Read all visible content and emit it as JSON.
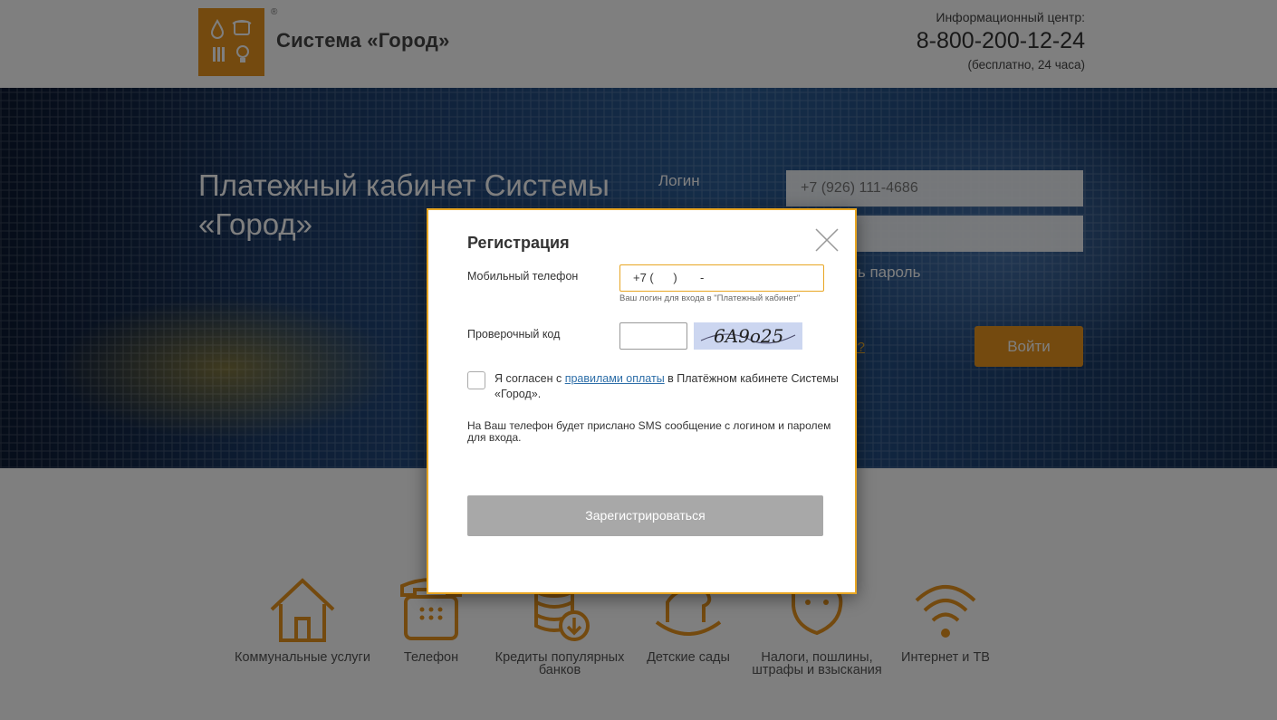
{
  "header": {
    "brand": "Система «Город»",
    "registered_mark": "®",
    "info_label": "Информационный центр:",
    "phone": "8-800-200-12-24",
    "phone_note": "(бесплатно, 24 часа)"
  },
  "hero": {
    "title": "Платежный кабинет Системы «Город»",
    "login_label": "Логин",
    "login_placeholder": "+7 (926) 111-4686",
    "remember_text": "ать пароль",
    "forgot_text": "ль?",
    "login_button": "Войти"
  },
  "services": [
    {
      "label": "Коммунальные услуги",
      "icon": "house-icon"
    },
    {
      "label": "Телефон",
      "icon": "phone-icon"
    },
    {
      "label": "Кредиты популярных банков",
      "icon": "coins-icon"
    },
    {
      "label": "Детские сады",
      "icon": "rocking-horse-icon"
    },
    {
      "label": "Налоги, пошлины, штрафы и взыскания",
      "icon": "piggy-icon"
    },
    {
      "label": "Интернет и ТВ",
      "icon": "wifi-icon"
    }
  ],
  "modal": {
    "title": "Регистрация",
    "phone_label": "Мобильный телефон",
    "phone_value": "+7 (      )       -",
    "phone_hint": "Ваш логин для входа в \"Платежный кабинет\"",
    "code_label": "Проверочный код",
    "captcha_text": "6A9o25",
    "agree_prefix": "Я согласен с ",
    "agree_link": "правилами оплаты",
    "agree_suffix": " в Платёжном кабинете Системы «Город».",
    "sms_note": "На Ваш телефон будет прислано SMS сообщение с логином и паролем для входа.",
    "submit": "Зарегистрироваться"
  },
  "colors": {
    "brand_orange": "#e8951e",
    "modal_border": "#e8a623",
    "link": "#2d6ea8",
    "submit_disabled": "#a8a8a8"
  }
}
